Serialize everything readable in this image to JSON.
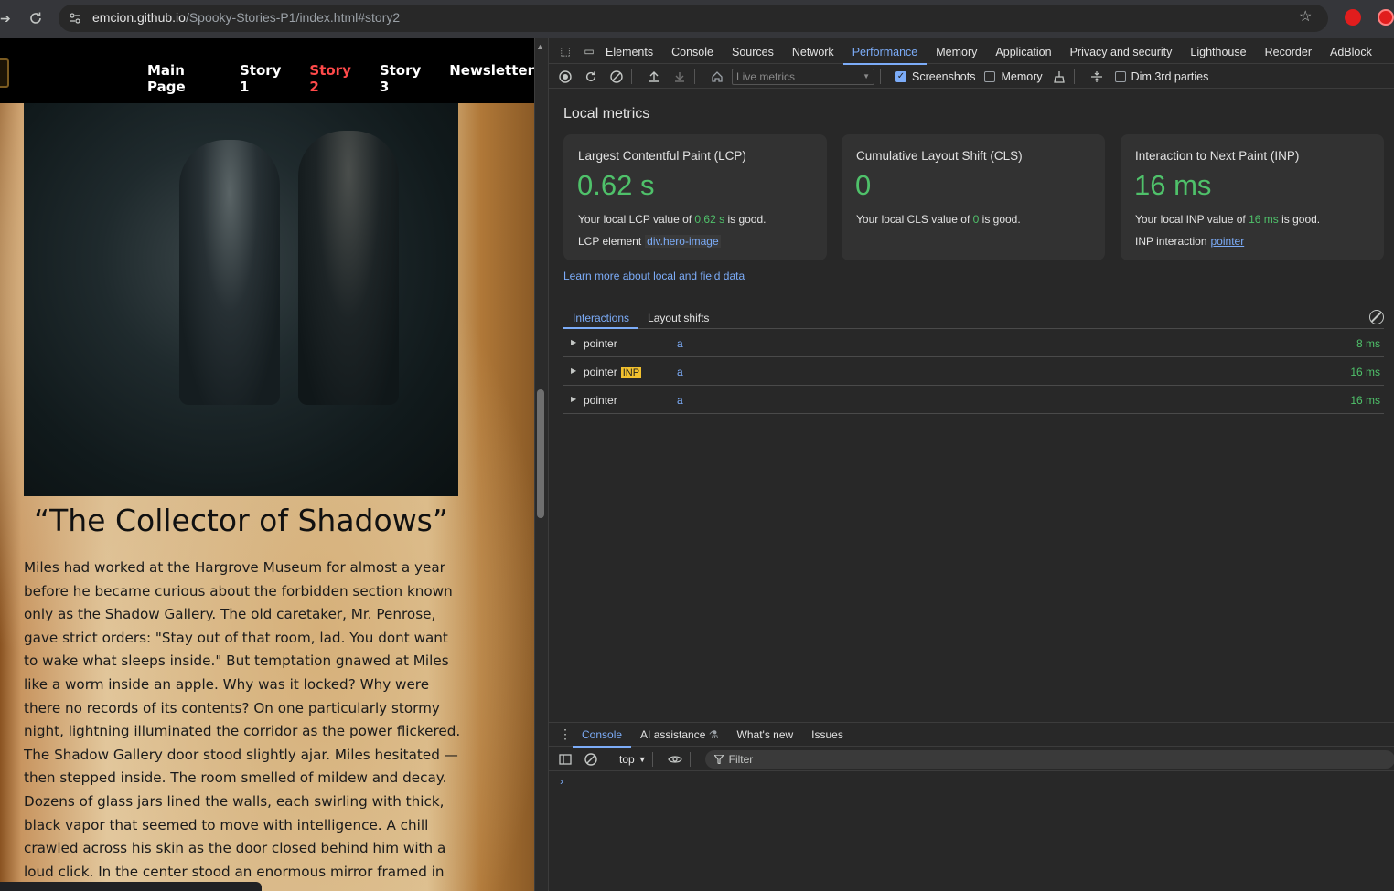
{
  "browser": {
    "url_host": "emcion.github.io",
    "url_path": "/Spooky-Stories-P1/index.html#story2"
  },
  "site": {
    "nav": [
      "Main Page",
      "Story 1",
      "Story 2",
      "Story 3",
      "Newsletter"
    ],
    "active_nav_index": 2,
    "story_title": "“The Collector of Shadows”",
    "story_body": "Miles had worked at the Hargrove Museum for almost a year before he became curious about the forbidden section known only as the Shadow Gallery. The old caretaker, Mr. Penrose, gave strict orders: \"Stay out of that room, lad. You dont want to wake what sleeps inside.\" But temptation gnawed at Miles like a worm inside an apple. Why was it locked? Why were there no records of its contents? On one particularly stormy night, lightning illuminated the corridor as the power flickered. The Shadow Gallery door stood slightly ajar. Miles hesitated — then stepped inside. The room smelled of mildew and decay. Dozens of glass jars lined the walls, each swirling with thick, black vapor that seemed to move with intelligence. A chill crawled across his skin as the door closed behind him with a loud click. In the center stood an enormous mirror framed in rusted iron. But the"
  },
  "devtools": {
    "tabs": [
      "Elements",
      "Console",
      "Sources",
      "Network",
      "Performance",
      "Memory",
      "Application",
      "Privacy and security",
      "Lighthouse",
      "Recorder",
      "AdBlock"
    ],
    "active_tab": "Performance",
    "toolbar": {
      "live_metrics": "Live metrics",
      "screenshots_label": "Screenshots",
      "screenshots_checked": true,
      "memory_label": "Memory",
      "memory_checked": false,
      "dim_label": "Dim 3rd parties",
      "dim_checked": false
    },
    "local_metrics_title": "Local metrics",
    "cards": [
      {
        "title": "Largest Contentful Paint (LCP)",
        "value": "0.62 s",
        "desc_pre": "Your local LCP value of ",
        "desc_val": "0.62 s",
        "desc_post": " is good.",
        "extra_label": "LCP element",
        "extra_value": "div.hero-image"
      },
      {
        "title": "Cumulative Layout Shift (CLS)",
        "value": "0",
        "desc_pre": "Your local CLS value of ",
        "desc_val": "0",
        "desc_post": " is good."
      },
      {
        "title": "Interaction to Next Paint (INP)",
        "value": "16 ms",
        "desc_pre": "Your local INP value of ",
        "desc_val": "16 ms",
        "desc_post": " is good.",
        "extra_label": "INP interaction",
        "extra_value": "pointer"
      }
    ],
    "learn_more": "Learn more about local and field data",
    "subtabs": [
      "Interactions",
      "Layout shifts"
    ],
    "interactions": [
      {
        "type": "pointer",
        "badge": "",
        "element": "a",
        "duration": "8 ms"
      },
      {
        "type": "pointer",
        "badge": "INP",
        "element": "a",
        "duration": "16 ms"
      },
      {
        "type": "pointer",
        "badge": "",
        "element": "a",
        "duration": "16 ms"
      }
    ],
    "drawer": {
      "tabs": [
        "Console",
        "AI assistance",
        "What's new",
        "Issues"
      ],
      "active_tab": "Console",
      "context": "top",
      "filter_placeholder": "Filter"
    }
  }
}
